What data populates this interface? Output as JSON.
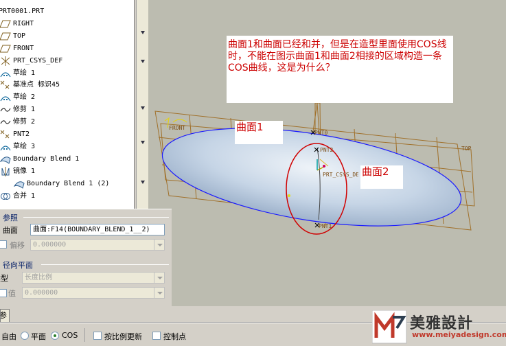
{
  "model_tree": {
    "items": [
      {
        "label": "PRT0001.PRT",
        "icon": "part-icon"
      },
      {
        "label": "RIGHT",
        "icon": "datum-plane-icon"
      },
      {
        "label": "TOP",
        "icon": "datum-plane-icon"
      },
      {
        "label": "FRONT",
        "icon": "datum-plane-icon"
      },
      {
        "label": "PRT_CSYS_DEF",
        "icon": "csys-icon"
      },
      {
        "label": "草绘 1",
        "icon": "sketch-icon"
      },
      {
        "label": "基准点 标识45",
        "icon": "datum-point-icon"
      },
      {
        "label": "草绘 2",
        "icon": "sketch-icon"
      },
      {
        "label": "修剪 1",
        "icon": "curve-icon"
      },
      {
        "label": "修剪 2",
        "icon": "curve-icon"
      },
      {
        "label": "PNT2",
        "icon": "datum-point-icon"
      },
      {
        "label": "草绘 3",
        "icon": "sketch-icon"
      },
      {
        "label": "Boundary Blend 1",
        "icon": "boundary-blend-icon"
      },
      {
        "label": "镜像 1",
        "icon": "mirror-icon"
      },
      {
        "label": "Boundary Blend 1 (2)",
        "icon": "boundary-blend-icon"
      },
      {
        "label": "合并 1",
        "icon": "merge-icon"
      }
    ]
  },
  "viewport": {
    "question_text": "曲面1和曲面已经和并，但是在造型里面使用COS线时，不能在图示曲面1和曲面2相接的区域构造一条COS曲线，这是为什么？",
    "label_surface1": "曲面1",
    "label_surface2": "曲面2",
    "datum_labels": {
      "front": "FRONT",
      "top": "TOP",
      "pnt0": "PNT0",
      "pnt2": "PNT2",
      "pnt1": "PNT1",
      "csys": "PRT_CSYS_DEF"
    },
    "colors": {
      "annotation": "#cc0000",
      "surface_edge": "#1a1aff",
      "datum": "#a0702a"
    }
  },
  "reference": {
    "section_title": "参照",
    "surface_label": "曲面",
    "surface_value": "曲面:F14(BOUNDARY_BLEND_1__2)",
    "offset_label": "偏移",
    "offset_value": "0.000000"
  },
  "radial_plane": {
    "section_title": "径向平面",
    "type_label": "类型",
    "type_value": "长度比例",
    "value_label": "值",
    "value_value": "0.000000"
  },
  "bottom": {
    "ref_button": "参照",
    "auto_label": "自由",
    "plane_label": "平面",
    "cos_label": "COS",
    "cos_selected": true,
    "update_label": "按比例更新",
    "control_point_label": "控制点"
  },
  "watermark": {
    "brand": "美雅設計",
    "url": "www.meiyadesign.com"
  }
}
